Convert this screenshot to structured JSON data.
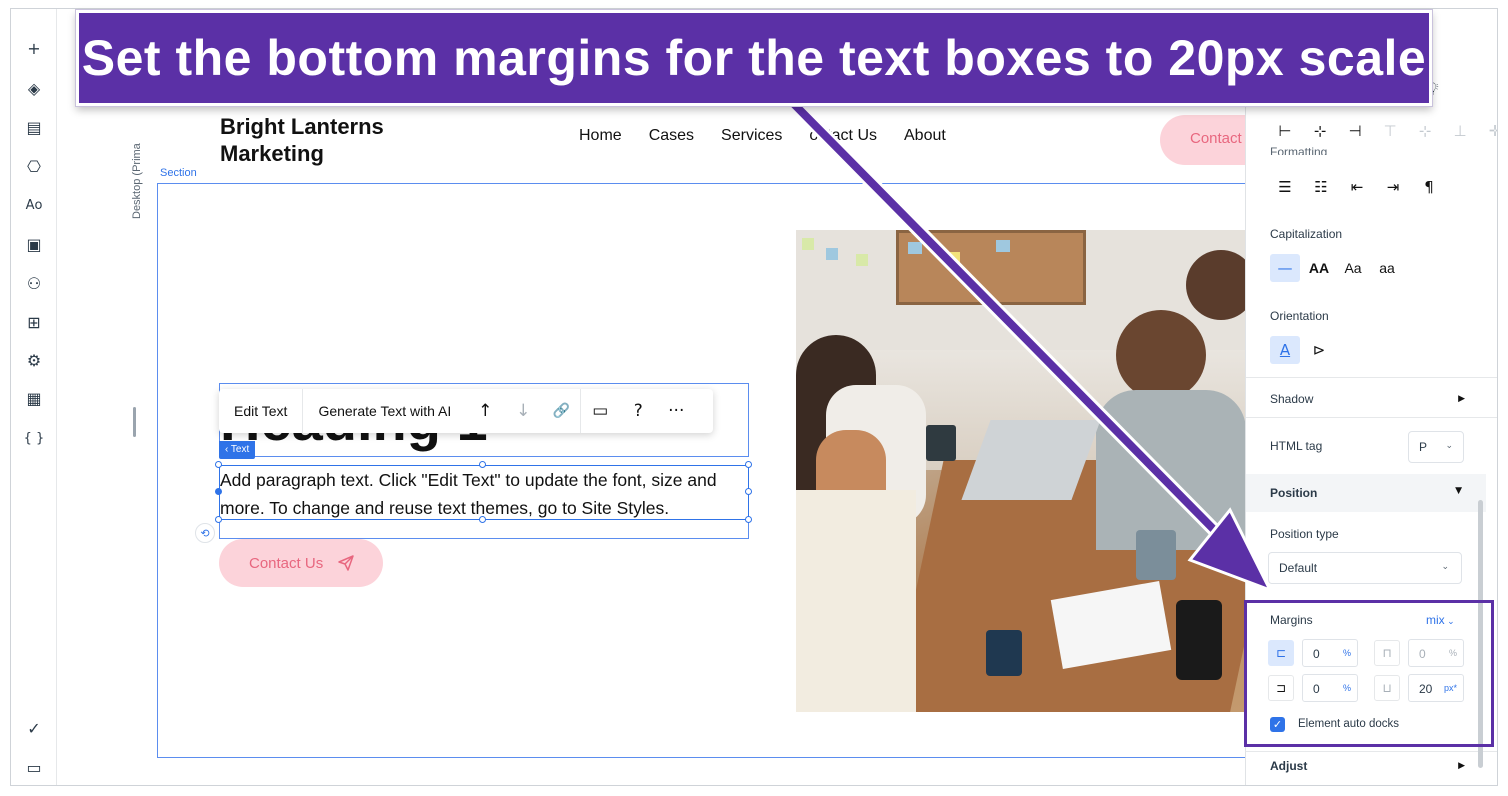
{
  "banner": {
    "text": "Set the bottom margins for the text boxes to 20px scale"
  },
  "left_toolbar": {
    "icons": [
      "add-icon",
      "layers-icon",
      "pages-icon",
      "sitemap-icon",
      "theme-icon",
      "media-icon",
      "apps-icon",
      "app-market-icon",
      "business-tools-icon",
      "cms-icon",
      "code-icon",
      "checklist-icon",
      "chat-icon"
    ],
    "glyphs": [
      "+",
      "◈",
      "▤",
      "⎔",
      "Aᴏ",
      "▣",
      "⚇",
      "⊞",
      "⚙",
      "▦",
      "{ }",
      "✓",
      "▭"
    ]
  },
  "ruler": {
    "label": "Desktop (Prima"
  },
  "site": {
    "brand": "Bright Lanterns Marketing",
    "nav": [
      "Home",
      "Cases",
      "Services",
      "ontact Us",
      "About"
    ],
    "header_cta": "Contact",
    "section_label": "Section",
    "heading": "Heading 1",
    "text_tag": "‹ Text",
    "paragraph": "Add paragraph text. Click \"Edit Text\" to update the font, size and more. To change and reuse text themes, go to Site Styles.",
    "contact_button": "Contact Us",
    "contact_icon": "send-icon"
  },
  "floating_toolbar": {
    "edit_text": "Edit Text",
    "generate_ai": "Generate Text with AI",
    "move_up": "↑",
    "move_down": "↓",
    "link": "🔗",
    "comment": "▭",
    "help": "?",
    "more": "···"
  },
  "panel": {
    "capitalization_label": "Capitalization",
    "capitalization_options": [
      "—",
      "AA",
      "Aa",
      "aa"
    ],
    "orientation_label": "Orientation",
    "formatting_label": "Formatting",
    "shadow_label": "Shadow",
    "html_tag_label": "HTML tag",
    "html_tag_value": "P",
    "position_label": "Position",
    "position_type_label": "Position type",
    "position_type_value": "Default",
    "margins_label": "Margins",
    "margins_mode": "mix",
    "margin_left": "0",
    "margin_left_unit": "%",
    "margin_top": "0",
    "margin_top_unit": "%",
    "margin_right": "0",
    "margin_right_unit": "%",
    "margin_bottom": "20",
    "margin_bottom_unit": "px*",
    "auto_docks_label": "Element auto docks",
    "auto_docks_checked": true,
    "adjust_label": "Adjust"
  },
  "colors": {
    "banner_bg": "#5b30a6",
    "selection_blue": "#2f73e8",
    "cta_pink": "#fcd3da",
    "cta_text": "#e8677f"
  }
}
